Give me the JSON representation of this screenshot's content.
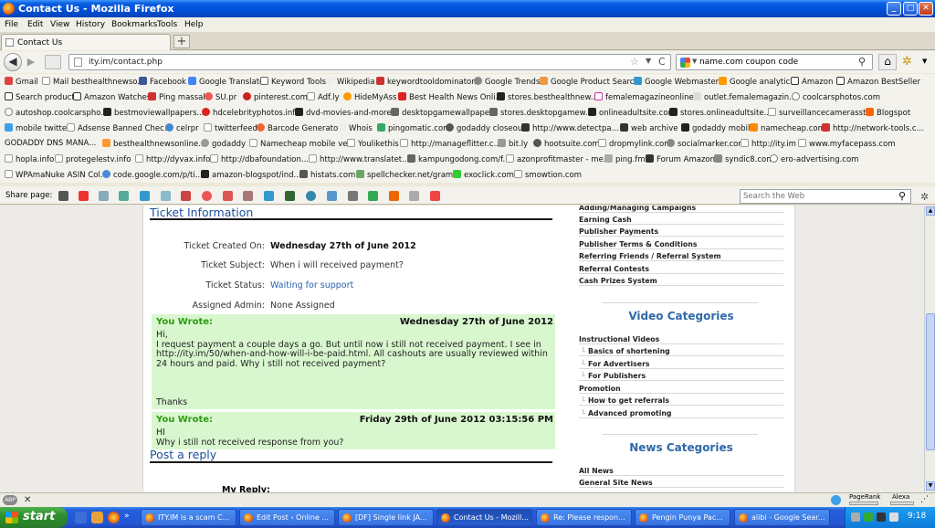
{
  "window": {
    "title": "Contact Us - Mozilla Firefox",
    "min_label": "_",
    "max_label": "□",
    "close_label": "✕"
  },
  "menu": [
    "File",
    "Edit",
    "View",
    "History",
    "Bookmarks",
    "Tools",
    "Help"
  ],
  "tab": {
    "label": "Contact Us",
    "new_tab": "+"
  },
  "nav": {
    "url": "ity.im/contact.php",
    "search_value": "name.com coupon code",
    "back": "◀",
    "forward": "▶",
    "star": "☆",
    "reload": "C",
    "home": "⌂",
    "gear": "✲"
  },
  "bookmarks": {
    "row1": [
      "Gmail",
      "Mail besthealthnewso...",
      "Facebook",
      "Google Translate",
      "Keyword Tools",
      "Wikipedia",
      "keywordtooldominator...",
      "Google Trends",
      "Google Product Search",
      "Google Webmasters",
      "Google analytic",
      "Amazon",
      "Amazon BestSeller"
    ],
    "row2": [
      "Search product",
      "Amazon Watches",
      "Ping massal",
      "SU.pr",
      "pinterest.com",
      "Adf.ly",
      "HideMyAss",
      "Best Health News Onli...",
      "stores.besthealthnew...",
      "femalemagazineonline...",
      "outlet.femalemagazin...",
      "coolcarsphotos.com"
    ],
    "row3": [
      "autoshop.coolcarspho...",
      "bestmoviewallpapers....",
      "hdcelebrityphotos.info",
      "dvd-movies-and-more...",
      "desktopgamewallpape...",
      "stores.desktopgamew...",
      "onlineadultsite.com",
      "stores.onlineadultsite....",
      "surveillancecamerasst...",
      "Blogspot"
    ],
    "row4": [
      "mobile twitter",
      "Adsense Banned Chec...",
      "celrpr",
      "twitterfeed",
      "Barcode Generator",
      "Whois",
      "pingomatic.com",
      "godaddy closeout",
      "http://www.detectpa...",
      "web archive",
      "godaddy mobile",
      "namecheap.com",
      "http://network-tools.c..."
    ],
    "row5": [
      "GODADDY DNS MANA...",
      "besthealthnewsonline...",
      "godaddy",
      "Namecheap mobile ve...",
      "Youlikethis",
      "http://manageflitter.c...",
      "bit.ly",
      "hootsuite.com",
      "dropmylink.com",
      "socialmarker.com",
      "http://ity.im",
      "www.myfacepass.com"
    ],
    "row6": [
      "hopla.info",
      "protegelestv.info",
      "http://dyvax.info/",
      "http://dbafoundation....",
      "http://www.translatet...",
      "kampungodong.com/f...",
      "azonprofitmaster - me...",
      "ping.fm",
      "Forum Amazon",
      "syndic8.com",
      "ero-advertising.com"
    ],
    "row7": [
      "WPAmaNuke ASIN Col...",
      "code.google.com/p/ti...",
      "amazon-blogspot/ind...",
      "histats.com",
      "spellchecker.net/gram...",
      "exoclick.com",
      "smowtion.com"
    ]
  },
  "share": {
    "label": "Share page:",
    "search_placeholder": "Search the Web"
  },
  "ticket": {
    "section_title": "Ticket Information",
    "created_label": "Ticket Created On:",
    "created_value": "Wednesday 27th of June 2012",
    "subject_label": "Ticket Subject:",
    "subject_value": "When i will received payment?",
    "status_label": "Ticket Status:",
    "status_value": "Waiting for support",
    "admin_label": "Assigned Admin:",
    "admin_value": "None Assigned"
  },
  "messages": [
    {
      "who": "You Wrote:",
      "when": "Wednesday 27th of June 2012",
      "body": "Hi,\nI request payment a couple days a go. But until now i still not received payment. I see in http://ity.im/50/when-and-how-will-i-be-paid.html. All cashouts are usually reviewed within 24 hours and paid. Why i still not received payment?",
      "thanks": "Thanks"
    },
    {
      "who": "You Wrote:",
      "when": "Friday 29th of June 2012 03:15:56 PM",
      "body": "HI\nWhy i still not received response from you?"
    }
  ],
  "reply": {
    "title": "Post a reply",
    "my_reply": "My Reply:"
  },
  "sidebar": {
    "top_items": [
      "Adding/Managing Campaigns",
      "Earning Cash",
      "Publisher Payments",
      "Publisher Terms & Conditions",
      "Referring Friends / Referral System",
      "Referral Contests",
      "Cash Prizes System"
    ],
    "video_heading": "Video Categories",
    "video_items": [
      {
        "label": "Instructional Videos",
        "sub": false
      },
      {
        "label": "Basics of shortening",
        "sub": true
      },
      {
        "label": "For Advertisers",
        "sub": true
      },
      {
        "label": "For Publishers",
        "sub": true
      },
      {
        "label": "Promotion",
        "sub": false
      },
      {
        "label": "How to get referrals",
        "sub": true
      },
      {
        "label": "Advanced promoting",
        "sub": true
      }
    ],
    "news_heading": "News Categories",
    "news_items": [
      "All News",
      "General Site News"
    ]
  },
  "statusbar": {
    "addon": "ABP",
    "close": "✕",
    "pagerank": "PageRank",
    "alexa": "Alexa",
    "pagerank_fill": 0
  },
  "taskbar": {
    "start": "start",
    "tasks": [
      "ITY.IM is a scam C...",
      "Edit Post ‹ Online ...",
      "[DF] Single link JA...",
      "Contact Us - Mozill...",
      "Re: Please respon...",
      "Pengin Punya Pac...",
      "alibi - Google Sear..."
    ],
    "active_index": 3,
    "clock": "9:18"
  }
}
